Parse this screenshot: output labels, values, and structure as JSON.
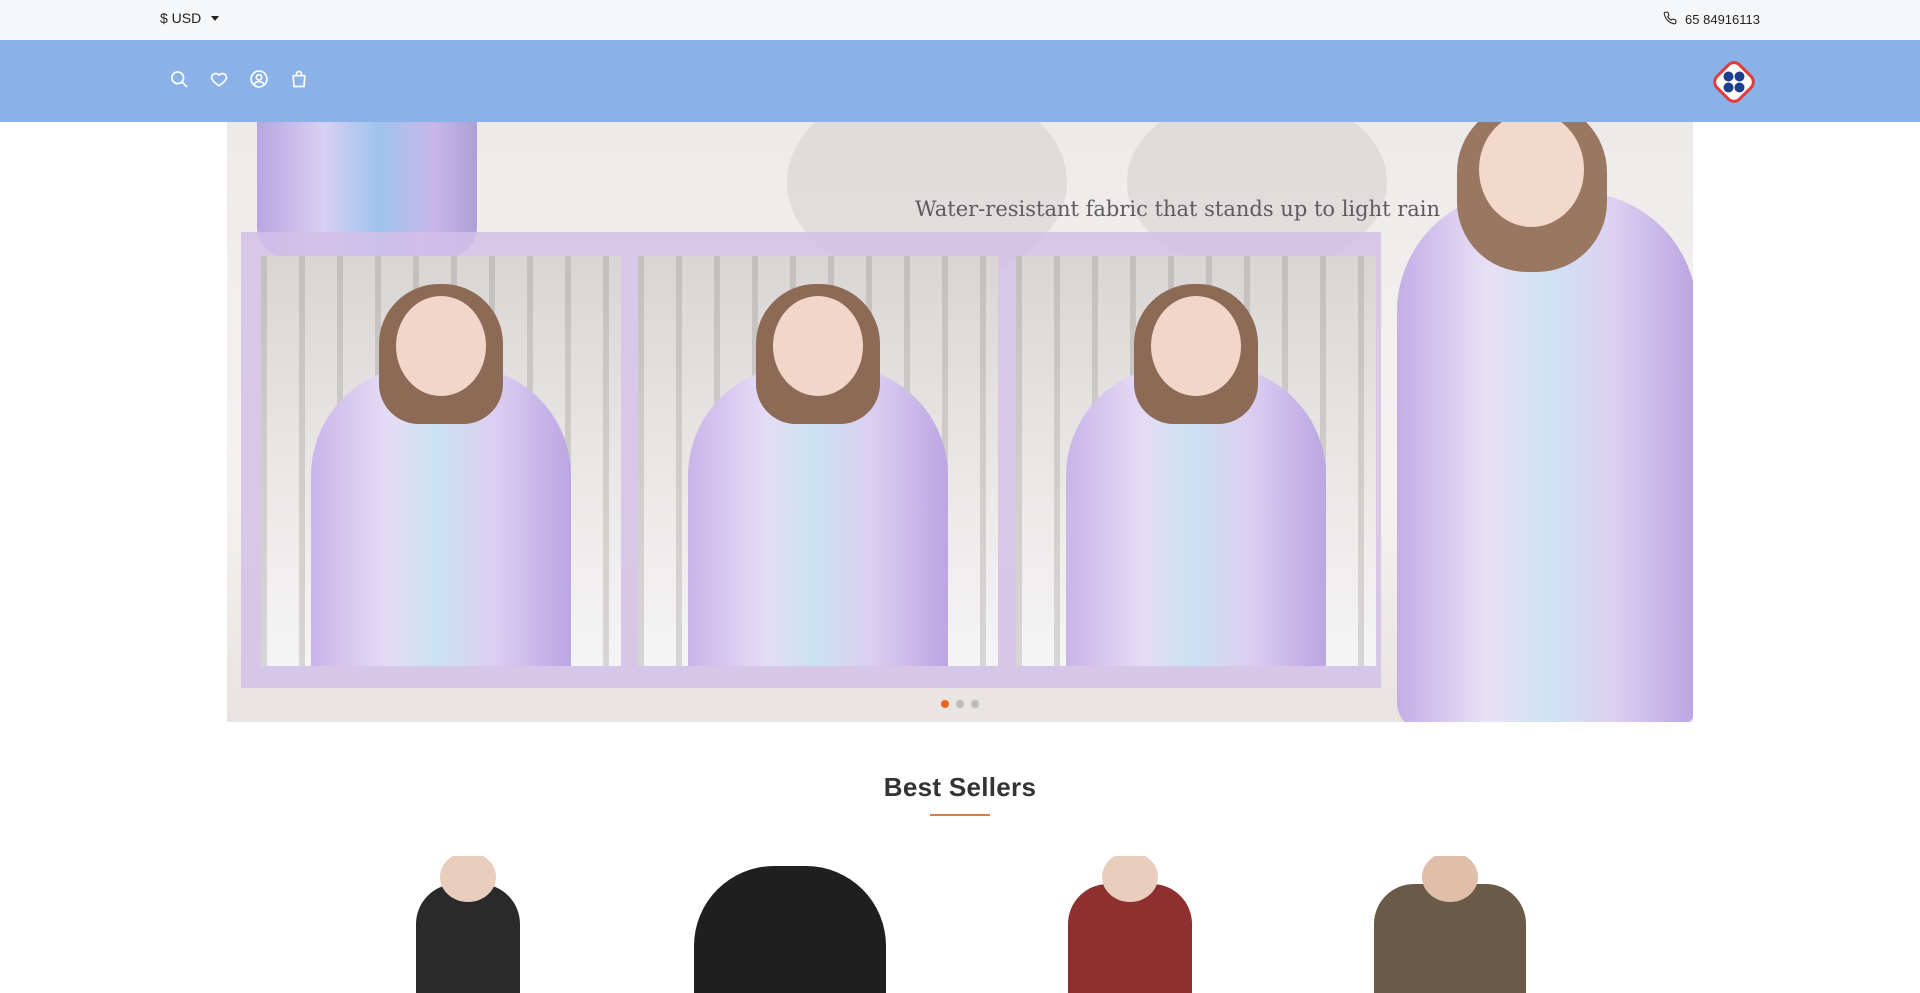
{
  "topbar": {
    "currency": "$ USD",
    "phone": "65 84916113"
  },
  "header": {
    "icons": [
      "search-icon",
      "heart-icon",
      "user-icon",
      "bag-icon"
    ],
    "logo_colors": {
      "ring": "#e23b3b",
      "dots": "#1c3e8c"
    }
  },
  "hero": {
    "caption": "Water-resistant fabric that stands up to light rain",
    "slides": 3,
    "active_slide": 1
  },
  "best_sellers": {
    "title": "Best Sellers",
    "products": [
      {
        "name": "black-long-coat",
        "color": "#2a2a2a"
      },
      {
        "name": "black-hooded-jacket",
        "color": "#1f1f1f"
      },
      {
        "name": "red-puffer-jacket",
        "color": "#8e2f30"
      },
      {
        "name": "brown-parka",
        "color": "#6b5a48"
      }
    ]
  },
  "colors": {
    "topbar_bg": "#f6f7f9",
    "header_bg": "#8ab2e8",
    "accent": "#e8651f",
    "collage_bg": "#d2c0e8"
  }
}
